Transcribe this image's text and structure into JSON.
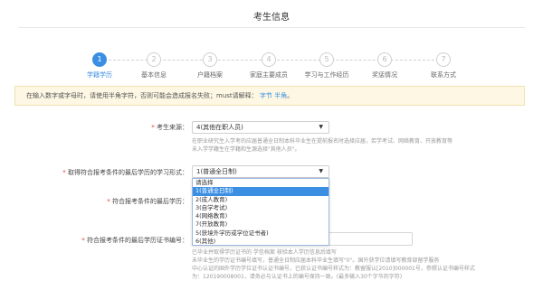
{
  "page_title": "考生信息",
  "steps": [
    {
      "num": "1",
      "label": "学籍学历"
    },
    {
      "num": "2",
      "label": "基本信息"
    },
    {
      "num": "3",
      "label": "户籍档案"
    },
    {
      "num": "4",
      "label": "家庭主要成员"
    },
    {
      "num": "5",
      "label": "学习与工作经历"
    },
    {
      "num": "6",
      "label": "奖惩情况"
    },
    {
      "num": "7",
      "label": "联系方式"
    }
  ],
  "notice": {
    "text": "在输入数字或字母时，请使用半角字符，否则可能会造成报名失败；must请解释：",
    "link1": "字节",
    "link2": "半角",
    "end": "。"
  },
  "form": {
    "source": {
      "label": "考生来源：",
      "value": "4(其他在职人员)",
      "hint1": "在职业研究生入学考的应届普通全日制本科毕业生在提前报名时选择应届，若学考试、网络教育、开放教育等",
      "hint2": "未入学学籍生在学籍和生源选择\"其他人员\"。"
    },
    "study_form": {
      "label": "取得符合报考条件的最后学历的学习形式：",
      "value": "1(普通全日制)"
    },
    "last_degree": {
      "label": "符合报考条件的最后学历："
    },
    "certificate": {
      "label": "符合报考条件的最后学历证书编号：",
      "hint1": "已毕业并取得学历证书的 学信档案 核验本人学历信息后填写",
      "hint2": "未毕业生的学历证书编号填写，普通全日制应届本科毕业生填写\"0\"。国外获学位请填写教育部留学服务",
      "hint3": "中心认证的国外学历学位证书认证书编号，已获认证书编号样式为：教留服认[2010]000001号，参照认证书编号样式",
      "hint4": "为：120190008001，请务必与认证书上的编号保持一致。(最多输入30个字节的字符)",
      "hint_link": "学信档案"
    },
    "options": [
      "请选择",
      "1(普通全日制)",
      "2(成人教育)",
      "3(自学考试)",
      "4(网络教育)",
      "7(开放教育)",
      "5(获境外学历或学位证书者)",
      "6(其他)"
    ],
    "selected_option_index": 1
  },
  "colors": {
    "accent": "#3b8fe3",
    "notice_bg": "#fdf7e3",
    "required": "#e33333"
  }
}
